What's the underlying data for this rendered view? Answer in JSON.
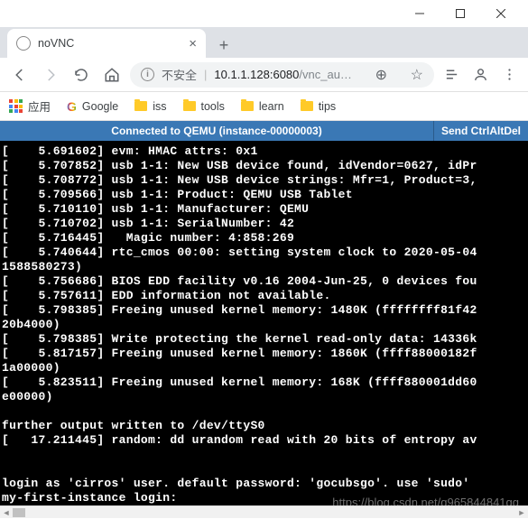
{
  "window": {
    "title": "noVNC"
  },
  "tab": {
    "title": "noVNC"
  },
  "omnibox": {
    "insecure_label": "不安全",
    "host": "10.1.1.128:6080",
    "path": "/vnc_au…"
  },
  "toolbar_icons": {
    "translate": "🌐"
  },
  "bookmarks": {
    "apps": "应用",
    "google": "Google",
    "iss": "iss",
    "tools": "tools",
    "learn": "learn",
    "tips": "tips"
  },
  "vnc": {
    "status": "Connected to QEMU (instance-00000003)",
    "send_button": "Send CtrlAltDel"
  },
  "terminal_lines": [
    "[    5.691602] evm: HMAC attrs: 0x1",
    "[    5.707852] usb 1-1: New USB device found, idVendor=0627, idPr",
    "[    5.708772] usb 1-1: New USB device strings: Mfr=1, Product=3,",
    "[    5.709566] usb 1-1: Product: QEMU USB Tablet",
    "[    5.710110] usb 1-1: Manufacturer: QEMU",
    "[    5.710702] usb 1-1: SerialNumber: 42",
    "[    5.716445]   Magic number: 4:858:269",
    "[    5.740644] rtc_cmos 00:00: setting system clock to 2020-05-04",
    "1588580273)",
    "[    5.756686] BIOS EDD facility v0.16 2004-Jun-25, 0 devices fou",
    "[    5.757611] EDD information not available.",
    "[    5.798385] Freeing unused kernel memory: 1480K (ffffffff81f42",
    "20b4000)",
    "[    5.798385] Write protecting the kernel read-only data: 14336k",
    "[    5.817157] Freeing unused kernel memory: 1860K (ffff88000182f",
    "1a00000)",
    "[    5.823511] Freeing unused kernel memory: 168K (ffff880001dd60",
    "e00000)",
    "",
    "further output written to /dev/ttyS0",
    "[   17.211445] random: dd urandom read with 20 bits of entropy av",
    "",
    "",
    "login as 'cirros' user. default password: 'gocubsgo'. use 'sudo'",
    "my-first-instance login:"
  ],
  "watermark": "https://blog.csdn.net/q965844841qq"
}
